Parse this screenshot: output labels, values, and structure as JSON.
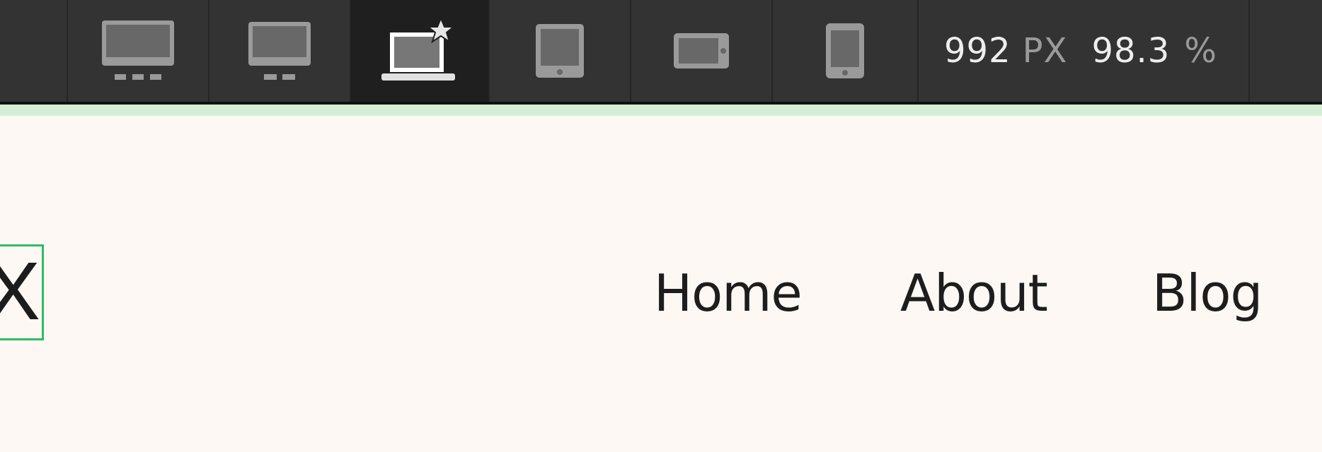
{
  "toolbar": {
    "devices": [
      {
        "name": "desktop-large",
        "active": false
      },
      {
        "name": "desktop",
        "active": false
      },
      {
        "name": "laptop-starred",
        "active": true
      },
      {
        "name": "tablet-portrait",
        "active": false
      },
      {
        "name": "tablet-landscape",
        "active": false
      },
      {
        "name": "phone",
        "active": false
      }
    ],
    "width_value": "992",
    "width_unit": "PX",
    "zoom_value": "98.3",
    "zoom_unit": "%"
  },
  "page": {
    "logo_text": "X",
    "nav": [
      "Home",
      "About",
      "Blog"
    ]
  },
  "colors": {
    "toolbar_bg": "#333333",
    "toolbar_active_bg": "#1f1f1f",
    "accent_bar": "#d4eed6",
    "canvas_bg": "#fdf8f4",
    "selection_outline": "#2ebd64",
    "text": "#1d1d1d"
  }
}
